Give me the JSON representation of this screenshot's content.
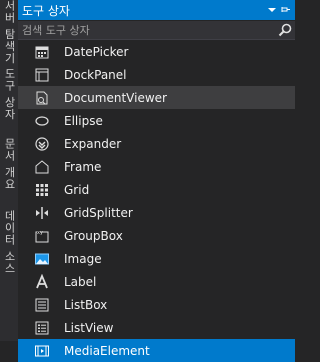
{
  "side_tabs": [
    {
      "label": "서버 탐색기"
    },
    {
      "label": "도구 상자"
    },
    {
      "label": "문서 개요"
    },
    {
      "label": "데이터 소스"
    }
  ],
  "panel": {
    "title": "도구 상자",
    "search_placeholder": "검색 도구 상자"
  },
  "items": [
    {
      "label": "DatePicker",
      "icon": "datepicker-icon"
    },
    {
      "label": "DockPanel",
      "icon": "dockpanel-icon"
    },
    {
      "label": "DocumentViewer",
      "icon": "documentviewer-icon",
      "state": "hover"
    },
    {
      "label": "Ellipse",
      "icon": "ellipse-icon"
    },
    {
      "label": "Expander",
      "icon": "expander-icon"
    },
    {
      "label": "Frame",
      "icon": "frame-icon"
    },
    {
      "label": "Grid",
      "icon": "grid-icon"
    },
    {
      "label": "GridSplitter",
      "icon": "gridsplitter-icon"
    },
    {
      "label": "GroupBox",
      "icon": "groupbox-icon"
    },
    {
      "label": "Image",
      "icon": "image-icon"
    },
    {
      "label": "Label",
      "icon": "label-icon"
    },
    {
      "label": "ListBox",
      "icon": "listbox-icon"
    },
    {
      "label": "ListView",
      "icon": "listview-icon"
    },
    {
      "label": "MediaElement",
      "icon": "mediaelement-icon",
      "state": "selected"
    }
  ],
  "colors": {
    "accent": "#007acc",
    "background": "#252526",
    "hover": "#3e3e40"
  }
}
